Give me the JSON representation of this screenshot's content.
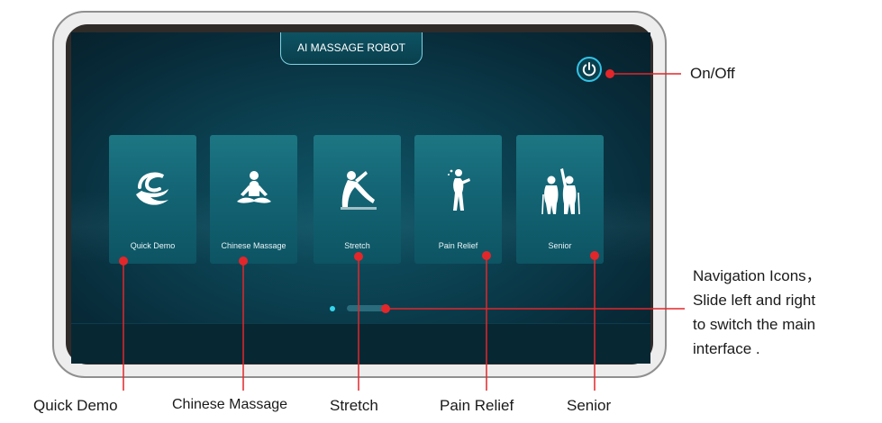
{
  "screen": {
    "title": "AI MASSAGE ROBOT",
    "power_icon": "power-icon",
    "cards": [
      {
        "label": "Quick Demo",
        "icon": "swirl-hand-icon"
      },
      {
        "label": "Chinese Massage",
        "icon": "meditation-icon"
      },
      {
        "label": "Stretch",
        "icon": "yoga-stretch-icon"
      },
      {
        "label": "Pain Relief",
        "icon": "pain-figure-icon"
      },
      {
        "label": "Senior",
        "icon": "elderly-couple-icon"
      }
    ],
    "pager": {
      "pages": 2,
      "current": 1
    }
  },
  "callouts": {
    "power": "On/Off",
    "bottom": [
      "Quick Demo",
      "Chinese Massage",
      "Stretch",
      "Pain Relief",
      "Senior"
    ],
    "navigation": [
      "Navigation Icons，",
      "Slide left and right",
      "to switch the main",
      "interface ."
    ]
  },
  "colors": {
    "accent_red": "#e3262a",
    "accent_cyan": "#34c3e6",
    "card_teal": "#136474"
  }
}
